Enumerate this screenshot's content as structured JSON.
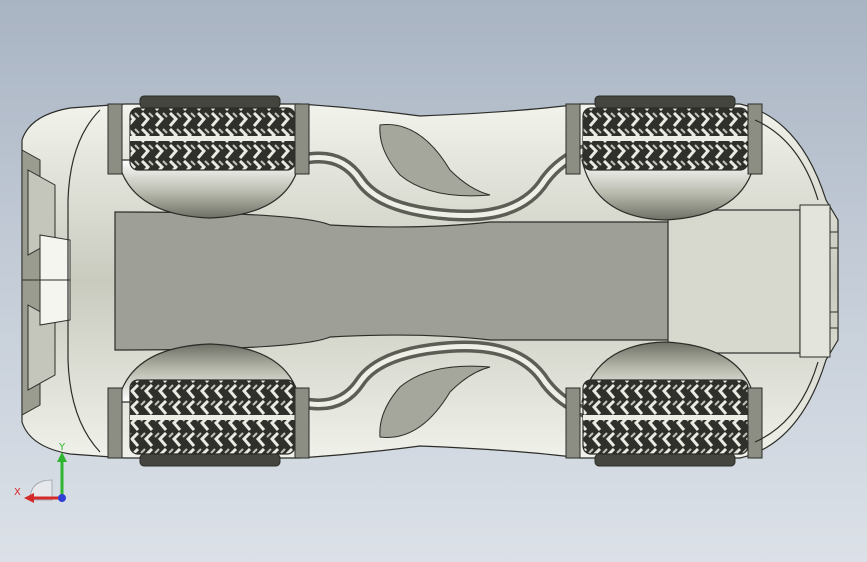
{
  "viewport": {
    "background_top": "#a9b4c3",
    "background_bottom": "#dce1e8",
    "model_color": "#d6d8ce",
    "model_shadow": "#6f7166",
    "panel_color": "#9e9f97",
    "edge_color": "#2c2d28",
    "tire_color": "#3a3b36"
  },
  "triad": {
    "x_label": "X",
    "y_label": "Y",
    "x_color": "#d42a2a",
    "y_color": "#2fb52f",
    "z_color": "#2f3fd6"
  }
}
